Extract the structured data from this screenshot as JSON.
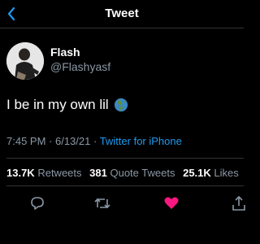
{
  "header": {
    "title": "Tweet",
    "back_icon": "back-arrow-icon"
  },
  "author": {
    "display_name": "Flash",
    "handle": "@Flashyasf"
  },
  "tweet": {
    "text": "I be in my own lil",
    "emoji": "globe-americas-icon"
  },
  "meta": {
    "time": "7:45 PM",
    "separator": " · ",
    "date": "6/13/21",
    "source": "Twitter for iPhone"
  },
  "stats": {
    "retweets": "13.7K",
    "retweets_label": "Retweets",
    "quote_tweets": "381",
    "quote_tweets_label": "Quote Tweets",
    "likes": "25.1K",
    "likes_label": "Likes"
  },
  "actions": [
    "reply-icon",
    "retweet-icon",
    "like-icon",
    "share-icon"
  ],
  "colors": {
    "accent": "#1d9bf0",
    "like": "#f91880",
    "muted": "#8b98a5",
    "background": "#000000"
  }
}
